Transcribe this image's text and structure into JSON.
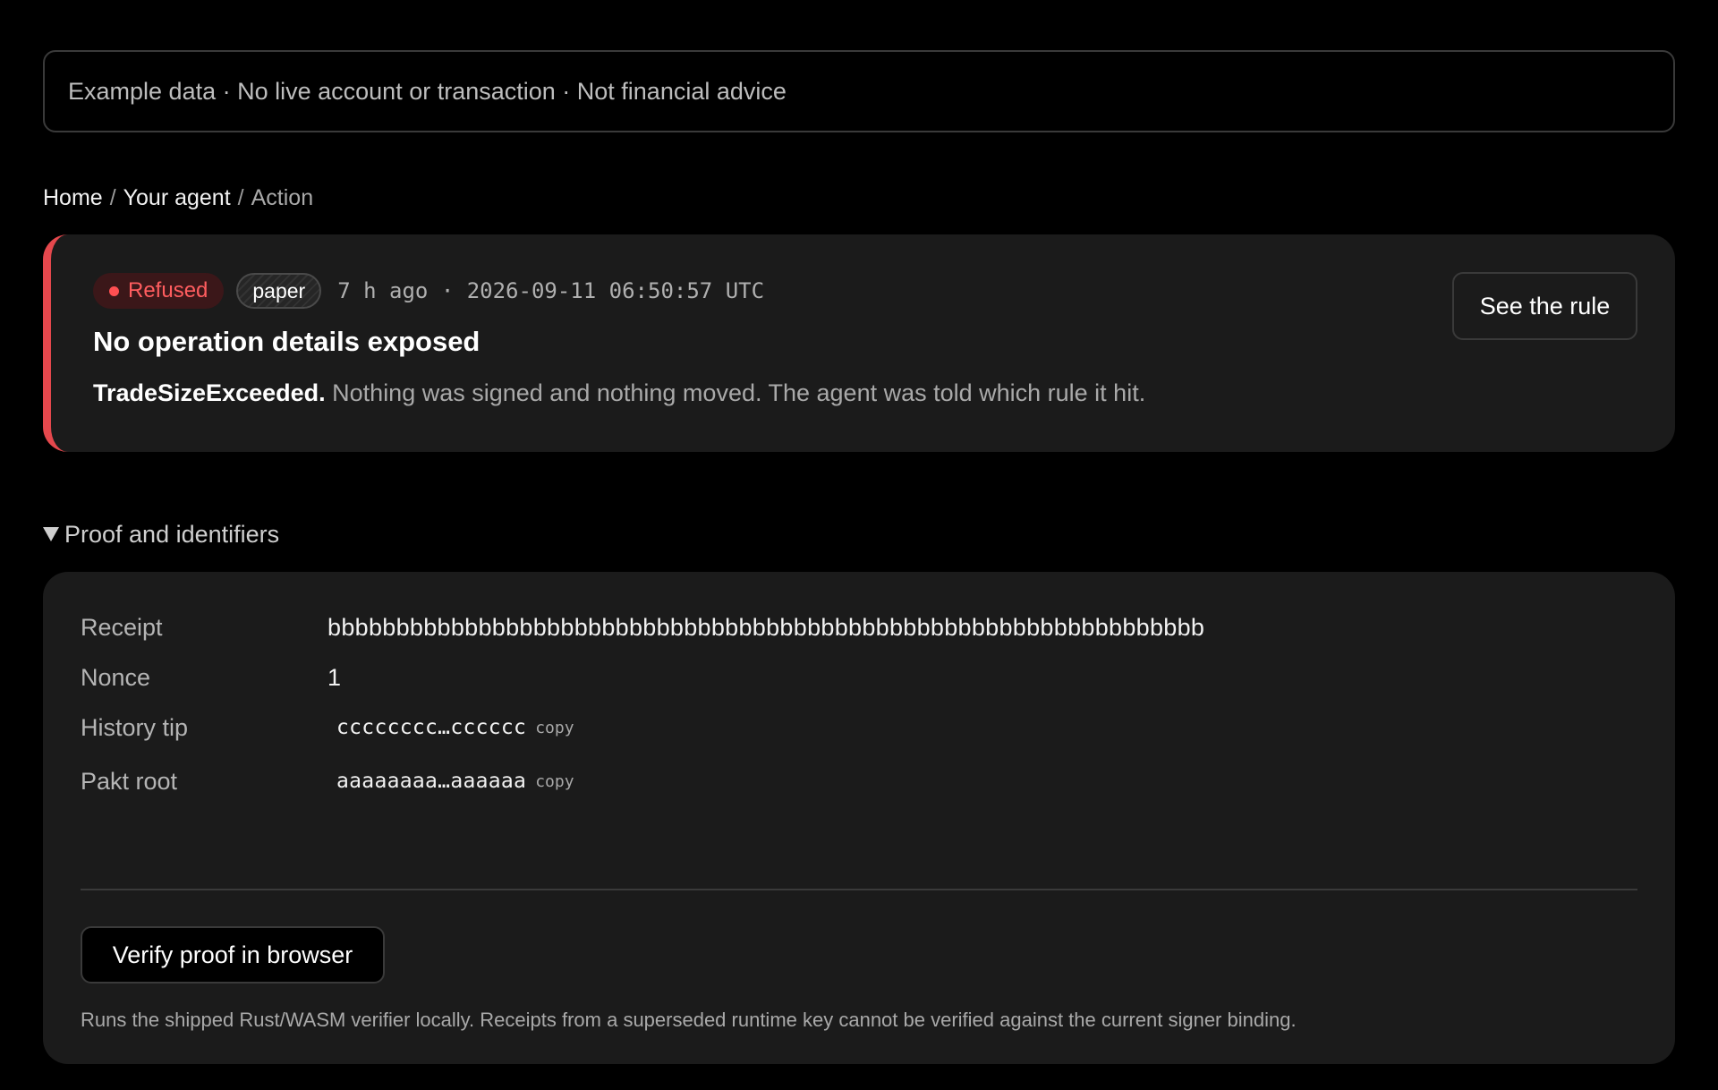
{
  "banner": {
    "text": "Example data · No live account or transaction · Not financial advice"
  },
  "breadcrumb": {
    "home": "Home",
    "agent": "Your agent",
    "current": "Action",
    "separator": "/"
  },
  "action": {
    "status": "Refused",
    "mode": "paper",
    "time": "7 h ago · 2026-09-11 06:50:57 UTC",
    "title": "No operation details exposed",
    "reason": "TradeSizeExceeded.",
    "description": "Nothing was signed and nothing moved. The agent was told which rule it hit.",
    "rule_button": "See the rule",
    "accent_color": "#e5484d"
  },
  "proof": {
    "summary": "Proof and identifiers",
    "rows": [
      {
        "label": "Receipt",
        "value": "bbbbbbbbbbbbbbbbbbbbbbbbbbbbbbbbbbbbbbbbbbbbbbbbbbbbbbbbbbbbbbbb"
      },
      {
        "label": "Nonce",
        "value": "1"
      },
      {
        "label": "History tip",
        "value": "cccccccc…cccccc",
        "copy": "copy"
      },
      {
        "label": "Pakt root",
        "value": "aaaaaaaa…aaaaaa",
        "copy": "copy"
      }
    ],
    "verify_button": "Verify proof in browser",
    "verify_note": "Runs the shipped Rust/WASM verifier locally. Receipts from a superseded runtime key cannot be verified against the current signer binding."
  },
  "icons": {
    "status_dot": "status-dot-icon",
    "disclosure": "triangle-down-icon"
  }
}
